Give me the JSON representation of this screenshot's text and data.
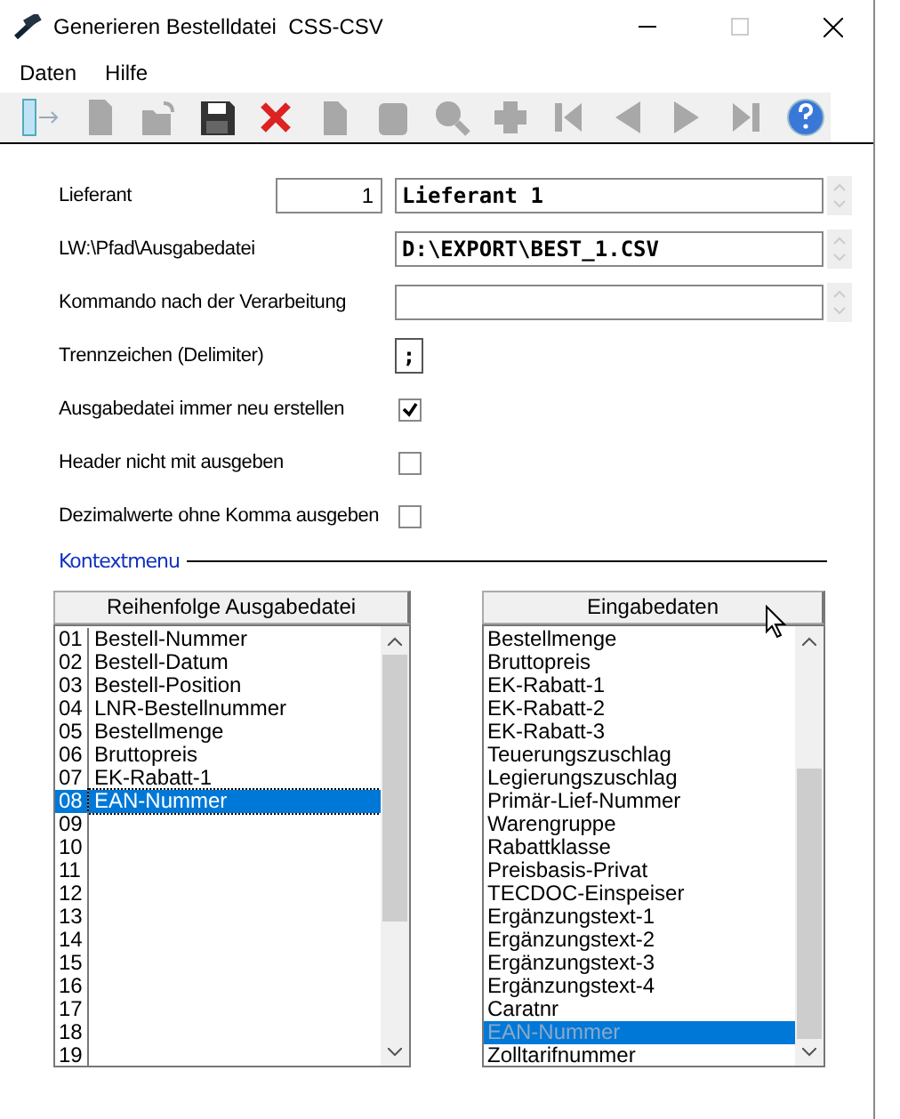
{
  "window": {
    "title": "Generieren Bestelldatei  CSS-CSV"
  },
  "menu": [
    "Daten",
    "Hilfe"
  ],
  "toolbar": [
    {
      "kind": "exit",
      "disabled": false
    },
    {
      "kind": "new",
      "disabled": true
    },
    {
      "kind": "open",
      "disabled": true
    },
    {
      "kind": "save",
      "disabled": false
    },
    {
      "kind": "delete",
      "disabled": false
    },
    {
      "kind": "copy",
      "disabled": true
    },
    {
      "kind": "paste",
      "disabled": true
    },
    {
      "kind": "search",
      "disabled": true
    },
    {
      "kind": "add",
      "disabled": true
    },
    {
      "kind": "first",
      "disabled": true
    },
    {
      "kind": "prev",
      "disabled": true
    },
    {
      "kind": "next",
      "disabled": true
    },
    {
      "kind": "last",
      "disabled": true
    },
    {
      "kind": "help",
      "disabled": false
    }
  ],
  "form": [
    {
      "kind": "lookup",
      "label": "Lieferant",
      "number": "1",
      "value": "Lieferant 1"
    },
    {
      "kind": "text",
      "label": "LW:\\Pfad\\Ausgabedatei",
      "value": "D:\\EXPORT\\BEST_1.CSV"
    },
    {
      "kind": "text",
      "label": "Kommando nach der Verarbeitung"
    },
    {
      "kind": "char",
      "label": "Trennzeichen (Delimiter)",
      "value": ";"
    },
    {
      "kind": "check",
      "label": "Ausgabedatei immer neu erstellen",
      "checked": true
    },
    {
      "kind": "check",
      "label": "Header nicht mit ausgeben",
      "checked": false
    },
    {
      "kind": "check",
      "label": "Dezimalwerte ohne Komma ausgeben",
      "checked": false
    }
  ],
  "section": "Kontextmenu",
  "output_list": {
    "heading": "Reihenfolge Ausgabedatei",
    "rows": [
      {
        "number": "01",
        "name": "Bestell-Nummer",
        "selected": false
      },
      {
        "number": "02",
        "name": "Bestell-Datum",
        "selected": false
      },
      {
        "number": "03",
        "name": "Bestell-Position",
        "selected": false
      },
      {
        "number": "04",
        "name": "LNR-Bestellnummer",
        "selected": false
      },
      {
        "number": "05",
        "name": "Bestellmenge",
        "selected": false
      },
      {
        "number": "06",
        "name": "Bruttopreis",
        "selected": false
      },
      {
        "number": "07",
        "name": "EK-Rabatt-1",
        "selected": false
      },
      {
        "number": "08",
        "name": "EAN-Nummer",
        "selected": true
      },
      {
        "number": "09",
        "selected": false
      },
      {
        "number": "10",
        "selected": false
      },
      {
        "number": "11",
        "selected": false
      },
      {
        "number": "12",
        "selected": false
      },
      {
        "number": "13",
        "selected": false
      },
      {
        "number": "14",
        "selected": false
      },
      {
        "number": "15",
        "selected": false
      },
      {
        "number": "16",
        "selected": false
      },
      {
        "number": "17",
        "selected": false
      },
      {
        "number": "18",
        "selected": false
      },
      {
        "number": "19",
        "selected": false
      }
    ]
  },
  "input_list": {
    "heading": "Eingabedaten",
    "rows": [
      {
        "name": "Bestellmenge",
        "selected": false
      },
      {
        "name": "Bruttopreis",
        "selected": false
      },
      {
        "name": "EK-Rabatt-1",
        "selected": false
      },
      {
        "name": "EK-Rabatt-2",
        "selected": false
      },
      {
        "name": "EK-Rabatt-3",
        "selected": false
      },
      {
        "name": "Teuerungszuschlag",
        "selected": false
      },
      {
        "name": "Legierungszuschlag",
        "selected": false
      },
      {
        "name": "Primär-Lief-Nummer",
        "selected": false
      },
      {
        "name": "Warengruppe",
        "selected": false
      },
      {
        "name": "Rabattklasse",
        "selected": false
      },
      {
        "name": "Preisbasis-Privat",
        "selected": false
      },
      {
        "name": "TECDOC-Einspeiser",
        "selected": false
      },
      {
        "name": "Ergänzungstext-1",
        "selected": false
      },
      {
        "name": "Ergänzungstext-2",
        "selected": false
      },
      {
        "name": "Ergänzungstext-3",
        "selected": false
      },
      {
        "name": "Ergänzungstext-4",
        "selected": false
      },
      {
        "name": "Caratnr",
        "selected": false
      },
      {
        "name": "EAN-Nummer",
        "selected": true
      },
      {
        "name": "Zolltarifnummer",
        "selected": false
      }
    ]
  }
}
